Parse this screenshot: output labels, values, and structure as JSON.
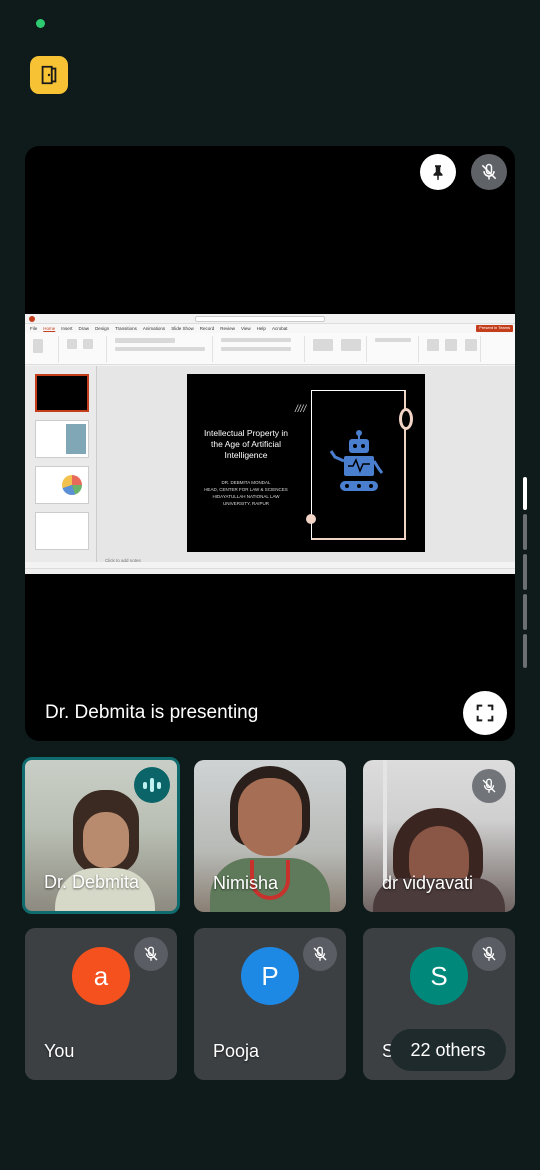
{
  "status": {
    "indicator": "green-dot",
    "color": "#2ecc71"
  },
  "exit_button": {
    "icon": "door-exit-icon",
    "color": "#f7c233"
  },
  "presentation": {
    "presenter_text": "Dr. Debmita is presenting",
    "pin_icon": "pin-icon",
    "mic_icon": "mic-off-icon",
    "fullscreen_icon": "fullscreen-icon",
    "shared_screen": {
      "app_menu": [
        "File",
        "Home",
        "Insert",
        "Draw",
        "Design",
        "Transitions",
        "Animations",
        "Slide Show",
        "Record",
        "Review",
        "View",
        "Help",
        "Acrobat"
      ],
      "present_button": "Present in Teams",
      "slide": {
        "title": "Intellectual Property in the Age of Artificial Intelligence",
        "author_lines": [
          "DR. DEBMITA MONDAL",
          "HEAD, CENTER FOR LAW & SCIENCES",
          "HIDAYATULLAH NATIONAL LAW",
          "UNIVERSITY, RAIPUR"
        ],
        "decoration": "////"
      },
      "notes_placeholder": "Click to add notes"
    }
  },
  "participants": [
    {
      "name": "Dr. Debmita",
      "speaking": true,
      "muted": false
    },
    {
      "name": "Nimisha",
      "speaking": false,
      "muted": false
    },
    {
      "name": "dr vidyavati",
      "speaking": false,
      "muted": true
    },
    {
      "name": "You",
      "avatar_letter": "a",
      "avatar_color": "#f4511e",
      "muted": true
    },
    {
      "name": "Pooja",
      "avatar_letter": "P",
      "avatar_color": "#1e88e5",
      "muted": true
    },
    {
      "name": "Su",
      "avatar_letter": "S",
      "avatar_color": "#00897b",
      "muted": true
    }
  ],
  "others": {
    "label": "22 others"
  }
}
